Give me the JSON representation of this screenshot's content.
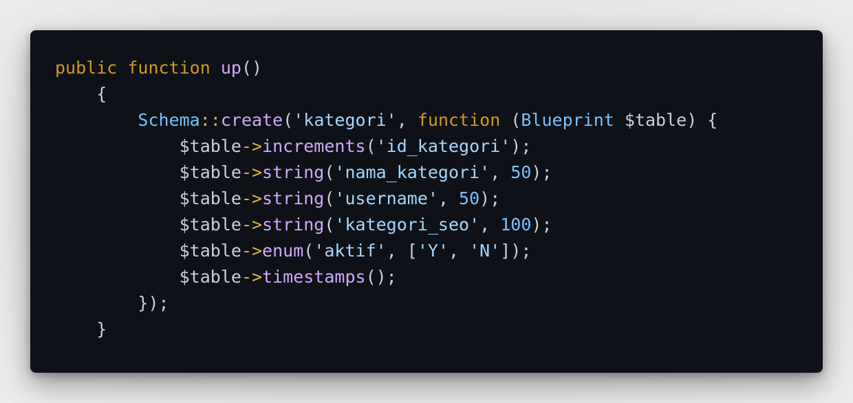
{
  "code": {
    "lines": [
      [
        {
          "t": "public",
          "c": "kw"
        },
        {
          "t": " ",
          "c": "punc"
        },
        {
          "t": "function",
          "c": "kw"
        },
        {
          "t": " ",
          "c": "punc"
        },
        {
          "t": "up",
          "c": "fn"
        },
        {
          "t": "()",
          "c": "punc"
        }
      ],
      [
        {
          "t": "    {",
          "c": "punc"
        }
      ],
      [
        {
          "t": "        ",
          "c": "punc"
        },
        {
          "t": "Schema",
          "c": "cls"
        },
        {
          "t": "::",
          "c": "op"
        },
        {
          "t": "create",
          "c": "fn"
        },
        {
          "t": "(",
          "c": "punc"
        },
        {
          "t": "'kategori'",
          "c": "str"
        },
        {
          "t": ", ",
          "c": "punc"
        },
        {
          "t": "function",
          "c": "kw"
        },
        {
          "t": " (",
          "c": "punc"
        },
        {
          "t": "Blueprint",
          "c": "cls"
        },
        {
          "t": " $table) {",
          "c": "punc"
        }
      ],
      [
        {
          "t": "            $table",
          "c": "var"
        },
        {
          "t": "->",
          "c": "op"
        },
        {
          "t": "increments",
          "c": "fn"
        },
        {
          "t": "(",
          "c": "punc"
        },
        {
          "t": "'id_kategori'",
          "c": "str"
        },
        {
          "t": ");",
          "c": "punc"
        }
      ],
      [
        {
          "t": "            $table",
          "c": "var"
        },
        {
          "t": "->",
          "c": "op"
        },
        {
          "t": "string",
          "c": "fn"
        },
        {
          "t": "(",
          "c": "punc"
        },
        {
          "t": "'nama_kategori'",
          "c": "str"
        },
        {
          "t": ", ",
          "c": "punc"
        },
        {
          "t": "50",
          "c": "num"
        },
        {
          "t": ");",
          "c": "punc"
        }
      ],
      [
        {
          "t": "            $table",
          "c": "var"
        },
        {
          "t": "->",
          "c": "op"
        },
        {
          "t": "string",
          "c": "fn"
        },
        {
          "t": "(",
          "c": "punc"
        },
        {
          "t": "'username'",
          "c": "str"
        },
        {
          "t": ", ",
          "c": "punc"
        },
        {
          "t": "50",
          "c": "num"
        },
        {
          "t": ");",
          "c": "punc"
        }
      ],
      [
        {
          "t": "            $table",
          "c": "var"
        },
        {
          "t": "->",
          "c": "op"
        },
        {
          "t": "string",
          "c": "fn"
        },
        {
          "t": "(",
          "c": "punc"
        },
        {
          "t": "'kategori_seo'",
          "c": "str"
        },
        {
          "t": ", ",
          "c": "punc"
        },
        {
          "t": "100",
          "c": "num"
        },
        {
          "t": ");",
          "c": "punc"
        }
      ],
      [
        {
          "t": "            $table",
          "c": "var"
        },
        {
          "t": "->",
          "c": "op"
        },
        {
          "t": "enum",
          "c": "fn"
        },
        {
          "t": "(",
          "c": "punc"
        },
        {
          "t": "'aktif'",
          "c": "str"
        },
        {
          "t": ", [",
          "c": "punc"
        },
        {
          "t": "'Y'",
          "c": "str"
        },
        {
          "t": ", ",
          "c": "punc"
        },
        {
          "t": "'N'",
          "c": "str"
        },
        {
          "t": "]);",
          "c": "punc"
        }
      ],
      [
        {
          "t": "            $table",
          "c": "var"
        },
        {
          "t": "->",
          "c": "op"
        },
        {
          "t": "timestamps",
          "c": "fn"
        },
        {
          "t": "();",
          "c": "punc"
        }
      ],
      [
        {
          "t": "        });",
          "c": "punc"
        }
      ],
      [
        {
          "t": "    }",
          "c": "punc"
        }
      ]
    ]
  }
}
